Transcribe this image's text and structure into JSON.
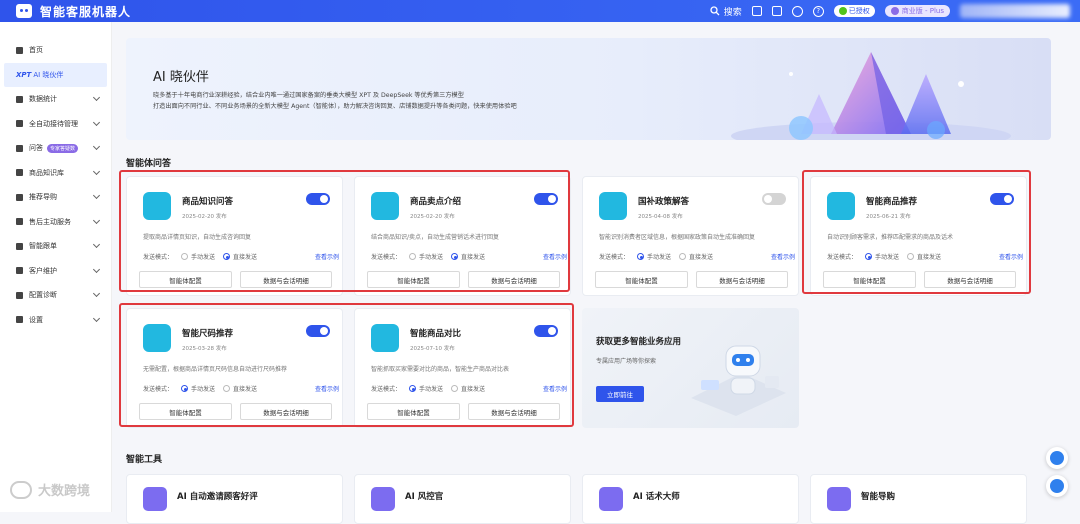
{
  "header": {
    "title": "智能客服机器人",
    "search_label": "搜索",
    "auth_label": "已授权",
    "plan_label": "商业版 - Plus"
  },
  "sidebar": {
    "items": [
      {
        "label": "首页",
        "chevron": false
      },
      {
        "label": "AI 晓伙伴",
        "brand": "XPT",
        "active": true
      },
      {
        "label": "数据统计",
        "chevron": true
      },
      {
        "label": "全自动接待管理",
        "chevron": true
      },
      {
        "label": "问答",
        "tag": "专家答疑数",
        "chevron": true
      },
      {
        "label": "商品知识库",
        "chevron": true
      },
      {
        "label": "推荐导购",
        "chevron": true
      },
      {
        "label": "售后主动服务",
        "chevron": true
      },
      {
        "label": "智能跟单",
        "chevron": true
      },
      {
        "label": "客户维护",
        "chevron": true
      },
      {
        "label": "配置诊断",
        "chevron": true
      },
      {
        "label": "设置",
        "chevron": true
      }
    ]
  },
  "hero": {
    "title": "AI 晓伙伴",
    "desc_line1": "晓多基于十年电商行业深耕经验，结合业内唯一通过国家备案的垂类大模型 XPT 及 DeepSeek 等优秀第三方模型",
    "desc_line2": "打造出面向不同行业、不同业务场景的全新大模型 Agent（智能体），助力解决咨询回复、店铺数据提升等各类问题，快来使用体验吧"
  },
  "sections": {
    "agents_title": "智能体问答",
    "tools_title": "智能工具"
  },
  "card_common": {
    "mode_label": "发送模式：",
    "manual_label": "手动发送",
    "direct_label": "直接发送",
    "example_label": "查看示例",
    "config_label": "智能体配置",
    "data_label": "数据与会话明细"
  },
  "agents": [
    {
      "name": "商品知识问答",
      "date": "2025-02-20 发布",
      "desc": "提取商品详情页知识，自动生成咨询回复",
      "enabled": true,
      "mode": "direct",
      "icon": "chat-bubble-icon",
      "color": "#22b8e0"
    },
    {
      "name": "商品卖点介绍",
      "date": "2025-02-20 发布",
      "desc": "结合商品知识/卖点，自动生成营销话术进行回复",
      "enabled": true,
      "mode": "direct",
      "icon": "shopping-bag-icon",
      "color": "#22b8e0"
    },
    {
      "name": "国补政策解答",
      "date": "2025-04-08 发布",
      "desc": "智能识别消费者区域信息，根据国家政策自动生成准确回复",
      "enabled": false,
      "mode": "manual",
      "icon": "ticket-icon",
      "color": "#22b8e0"
    },
    {
      "name": "智能商品推荐",
      "date": "2025-06-21 发布",
      "desc": "自动识别顾客需求，推荐匹配需求的商品及话术",
      "enabled": true,
      "mode": "manual",
      "icon": "robot-icon",
      "color": "#22b8e0"
    },
    {
      "name": "智能尺码推荐",
      "date": "2025-03-28 发布",
      "desc": "无需配置，根据商品详情页尺码信息自动进行尺码推荐",
      "enabled": true,
      "mode": "manual",
      "icon": "ruler-icon",
      "color": "#22b8e0"
    },
    {
      "name": "智能商品对比",
      "date": "2025-07-10 发布",
      "desc": "智能抓取买家需要对比的商品，智能生产商品对比表",
      "enabled": true,
      "mode": "manual",
      "icon": "compare-icon",
      "color": "#22b8e0"
    }
  ],
  "promo": {
    "title": "获取更多智能业务应用",
    "subtitle": "专属应用广场等你探索",
    "button": "立即前往"
  },
  "tools": [
    {
      "name": "AI 自动邀请顾客好评",
      "icon": "pen-icon",
      "color": "#7c6cf0"
    },
    {
      "name": "AI 风控官",
      "icon": "shield-icon",
      "color": "#7c6cf0"
    },
    {
      "name": "AI 话术大师",
      "icon": "chat-icon",
      "color": "#7c6cf0"
    },
    {
      "name": "智能导购",
      "icon": "guide-icon",
      "color": "#7c6cf0"
    }
  ],
  "watermark": "大数跨境"
}
